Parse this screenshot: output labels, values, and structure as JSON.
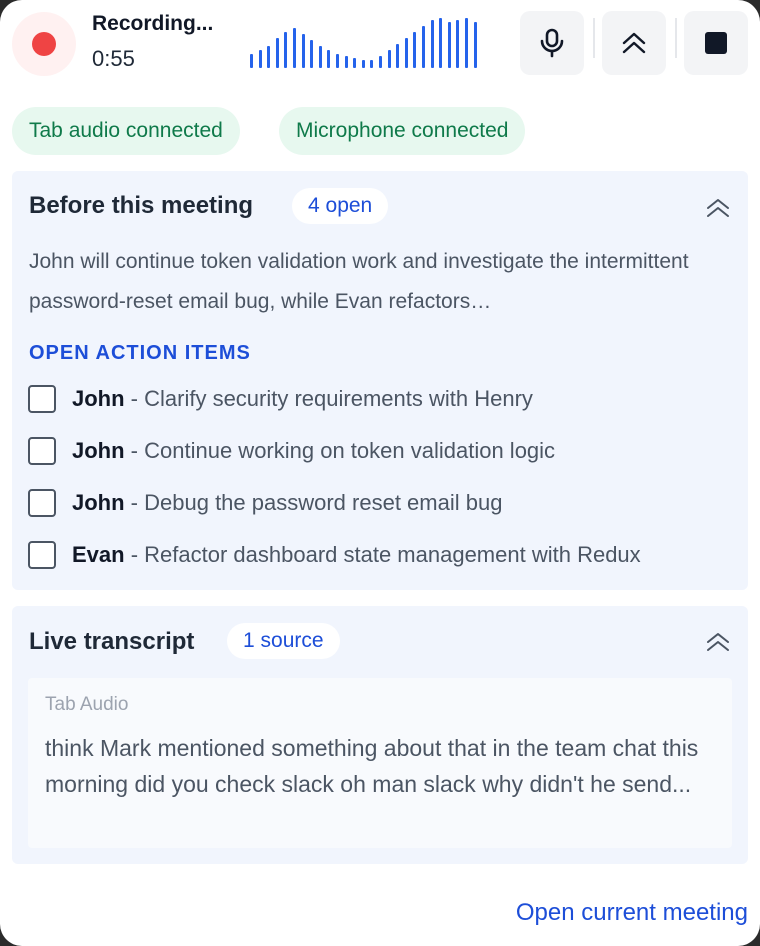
{
  "recorder": {
    "title": "Recording...",
    "elapsed": "0:55",
    "mic_button": "microphone-icon",
    "collapse_button": "chevrons-up-icon",
    "stop_button": "stop-icon"
  },
  "status_chips": [
    {
      "label": "Tab audio connected"
    },
    {
      "label": "Microphone connected"
    }
  ],
  "before_meeting": {
    "title": "Before this meeting",
    "badge": "4 open",
    "summary": "John will continue token validation work and investigate the intermittent password-reset email bug, while Evan refactors…",
    "section_label": "OPEN ACTION ITEMS",
    "action_items": [
      {
        "owner": "John",
        "separator": " - ",
        "text": "Clarify security requirements with Henry",
        "checked": false
      },
      {
        "owner": "John",
        "separator": " - ",
        "text": "Continue working on token validation logic",
        "checked": false
      },
      {
        "owner": "John",
        "separator": " - ",
        "text": "Debug the password reset email bug",
        "checked": false
      },
      {
        "owner": "Evan",
        "separator": " - ",
        "text": "Refactor dashboard state management with Redux",
        "checked": false
      }
    ]
  },
  "live_transcript": {
    "title": "Live transcript",
    "badge": "1 source",
    "source": "Tab Audio",
    "text": "think Mark mentioned something about that in the team chat this morning did you check slack oh man slack why didn't he send..."
  },
  "footer": {
    "open_link": "Open current meeting"
  },
  "colors": {
    "accent": "#1d4ed8",
    "recording": "#ef4444",
    "connected_bg": "#e7f8ef",
    "connected_text": "#0f7a4a",
    "card_bg": "#f1f5fd"
  }
}
